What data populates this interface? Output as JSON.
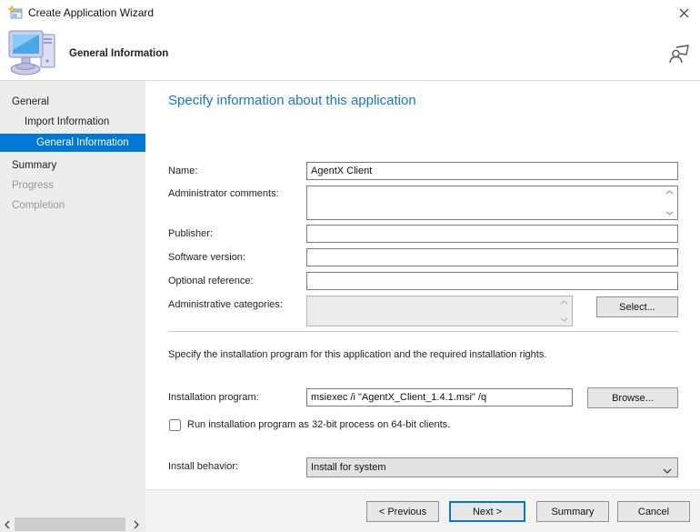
{
  "colors": {
    "accent": "#0078d7",
    "heading_blue": "#1777d2",
    "sidebar_selected_bg": "#0078d7",
    "sidebar_future_text": "#989898"
  },
  "window": {
    "title": "Create Application Wizard"
  },
  "header": {
    "title": "General Information"
  },
  "sidebar": {
    "items": [
      {
        "label": "General",
        "level": 0,
        "state": "dark"
      },
      {
        "label": "Import Information",
        "level": 1,
        "state": "dark"
      },
      {
        "label": "General Information",
        "level": 2,
        "state": "selected"
      },
      {
        "label": "Summary",
        "level": 0,
        "state": "dark"
      },
      {
        "label": "Progress",
        "level": 0,
        "state": "future"
      },
      {
        "label": "Completion",
        "level": 0,
        "state": "future"
      }
    ]
  },
  "main": {
    "heading": "Specify information about this application",
    "install_section_text": "Specify the installation program for this application and the required installation rights.",
    "fields": {
      "name": {
        "label": "Name:",
        "value": "AgentX Client"
      },
      "admin_comments": {
        "label": "Administrator comments:",
        "value": ""
      },
      "publisher": {
        "label": "Publisher:",
        "value": ""
      },
      "software_version": {
        "label": "Software version:",
        "value": ""
      },
      "optional_reference": {
        "label": "Optional reference:",
        "value": ""
      },
      "admin_categories": {
        "label": "Administrative categories:",
        "value": "",
        "button": "Select..."
      },
      "installation_program": {
        "label": "Installation program:",
        "value": "msiexec /i \"AgentX_Client_1.4.1.msi\" /q",
        "button": "Browse..."
      },
      "run_32bit": {
        "label": "Run installation program as 32-bit process on 64-bit clients.",
        "checked": false
      },
      "install_behavior": {
        "label": "Install behavior:",
        "value": "Install for system"
      }
    }
  },
  "footer": {
    "buttons": [
      {
        "label": "< Previous",
        "default": false
      },
      {
        "label": "Next >",
        "default": true
      },
      {
        "label": "Summary",
        "default": false
      },
      {
        "label": "Cancel",
        "default": false
      }
    ]
  }
}
